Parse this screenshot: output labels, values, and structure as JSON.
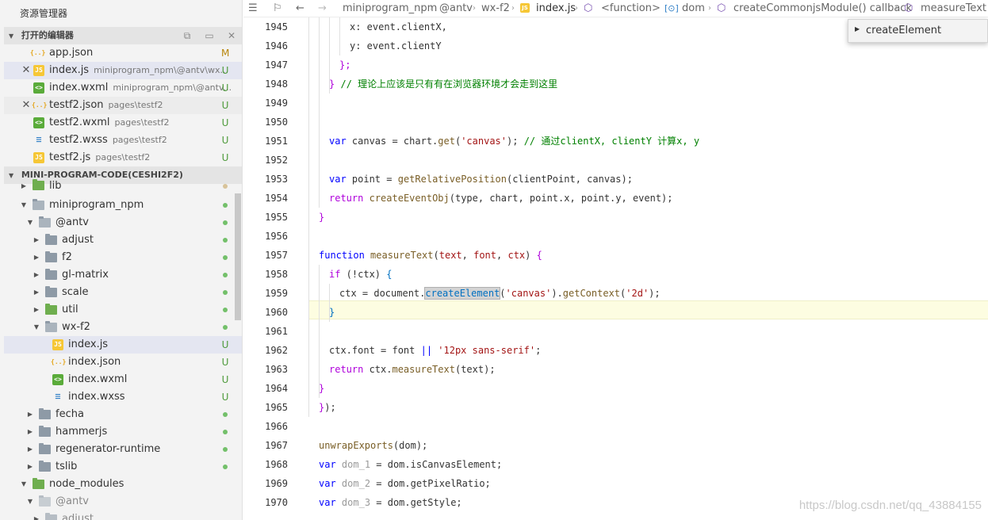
{
  "sidebar": {
    "title": "资源管理器",
    "open_editors": {
      "label": "打开的编辑器",
      "items": [
        {
          "name": "app.json",
          "desc": "",
          "status": "M",
          "icon": "json-icon",
          "closable": false
        },
        {
          "name": "index.js",
          "desc": "miniprogram_npm\\@antv\\wx...",
          "status": "U",
          "icon": "js-icon",
          "closable": true
        },
        {
          "name": "index.wxml",
          "desc": "miniprogram_npm\\@antv...",
          "status": "U",
          "icon": "wxml-icon",
          "closable": false
        },
        {
          "name": "testf2.json",
          "desc": "pages\\testf2",
          "status": "U",
          "icon": "json-icon",
          "closable": true
        },
        {
          "name": "testf2.wxml",
          "desc": "pages\\testf2",
          "status": "U",
          "icon": "wxml-icon",
          "closable": false
        },
        {
          "name": "testf2.wxss",
          "desc": "pages\\testf2",
          "status": "U",
          "icon": "wxss-icon",
          "closable": false
        },
        {
          "name": "testf2.js",
          "desc": "pages\\testf2",
          "status": "U",
          "icon": "js-icon",
          "closable": false
        }
      ]
    },
    "project": {
      "label": "MINI-PROGRAM-CODE(CESHI2F2)",
      "tree": [
        {
          "name": "lib",
          "kind": "folder-green"
        },
        {
          "name": "miniprogram_npm",
          "kind": "folder-open"
        },
        {
          "name": "@antv",
          "kind": "folder-open"
        },
        {
          "name": "adjust",
          "kind": "folder"
        },
        {
          "name": "f2",
          "kind": "folder"
        },
        {
          "name": "gl-matrix",
          "kind": "folder"
        },
        {
          "name": "scale",
          "kind": "folder"
        },
        {
          "name": "util",
          "kind": "folder-green"
        },
        {
          "name": "wx-f2",
          "kind": "folder-open"
        },
        {
          "name": "index.js",
          "kind": "js",
          "status": "U"
        },
        {
          "name": "index.json",
          "kind": "json",
          "status": "U"
        },
        {
          "name": "index.wxml",
          "kind": "wxml",
          "status": "U"
        },
        {
          "name": "index.wxss",
          "kind": "wxss",
          "status": "U"
        },
        {
          "name": "fecha",
          "kind": "folder"
        },
        {
          "name": "hammerjs",
          "kind": "folder"
        },
        {
          "name": "regenerator-runtime",
          "kind": "folder"
        },
        {
          "name": "tslib",
          "kind": "folder"
        },
        {
          "name": "node_modules",
          "kind": "folder-open"
        },
        {
          "name": "@antv",
          "kind": "folder-open"
        },
        {
          "name": "adjust",
          "kind": "folder"
        }
      ]
    }
  },
  "breadcrumb": [
    "miniprogram_npm",
    "@antv",
    "wx-f2",
    "index.js",
    "<function>",
    "dom",
    "createCommonjsModule() callback",
    "measureText"
  ],
  "suggestion": {
    "label": "createElement"
  },
  "code": {
    "line_numbers": [
      "1945",
      "1946",
      "1947",
      "1948",
      "1949",
      "1950",
      "1951",
      "1952",
      "1953",
      "1954",
      "1955",
      "1956",
      "1957",
      "1958",
      "1959",
      "1960",
      "1961",
      "1962",
      "1963",
      "1964",
      "1965",
      "1966",
      "1967",
      "1968",
      "1969",
      "1970"
    ],
    "lines": [
      "x: event.clientX,",
      "y: event.clientY",
      "};",
      "} // 理论上应该是只有有在浏览器环境才会走到这里",
      "",
      "",
      "var canvas = chart.get('canvas'); // 通过clientX, clientY 计算x, y",
      "",
      "var point = getRelativePosition(clientPoint, canvas);",
      "return createEventObj(type, chart, point.x, point.y, event);",
      "}",
      "",
      "function measureText(text, font, ctx) {",
      "if (!ctx) {",
      "ctx = document.createElement('canvas').getContext('2d');",
      "}",
      "",
      "ctx.font = font || '12px sans-serif';",
      "return ctx.measureText(text);",
      "}",
      "});",
      "",
      "unwrapExports(dom);",
      "var dom_1 = dom.isCanvasElement;",
      "var dom_2 = dom.getPixelRatio;",
      "var dom_3 = dom.getStyle;"
    ]
  },
  "watermark": "https://blog.csdn.net/qq_43884155",
  "colors": {
    "modified": "#b8860b",
    "untracked": "#4d9a3a",
    "dot": "#73c06a"
  }
}
